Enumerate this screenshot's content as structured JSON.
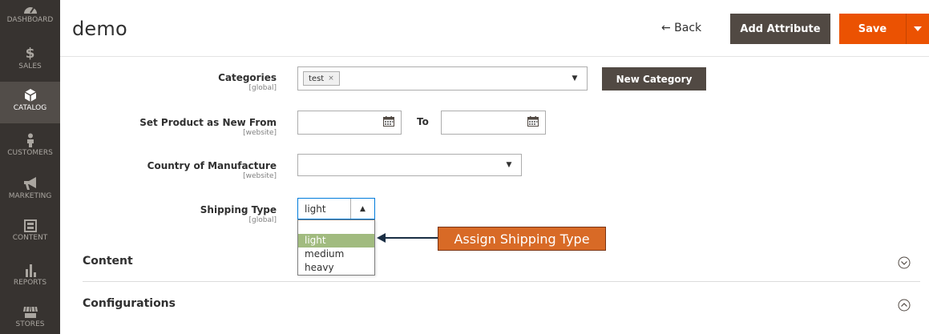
{
  "sidebar": {
    "items": [
      {
        "label": "DASHBOARD",
        "icon": "dashboard-icon"
      },
      {
        "label": "SALES",
        "icon": "dollar-icon"
      },
      {
        "label": "CATALOG",
        "icon": "cube-icon",
        "active": true
      },
      {
        "label": "CUSTOMERS",
        "icon": "person-icon"
      },
      {
        "label": "MARKETING",
        "icon": "megaphone-icon"
      },
      {
        "label": "CONTENT",
        "icon": "layout-icon"
      },
      {
        "label": "REPORTS",
        "icon": "bar-chart-icon"
      },
      {
        "label": "STORES",
        "icon": "store-icon"
      }
    ]
  },
  "header": {
    "title": "demo",
    "back_label": "← Back",
    "add_attribute_label": "Add Attribute",
    "save_label": "Save"
  },
  "form": {
    "categories": {
      "label": "Categories",
      "scope": "[global]",
      "tag": "test",
      "tag_remove": "×",
      "new_category_label": "New Category"
    },
    "new_from": {
      "label": "Set Product as New From",
      "scope": "[website]",
      "from_value": "",
      "to_label": "To",
      "to_value": ""
    },
    "country": {
      "label": "Country of Manufacture",
      "scope": "[website]",
      "value": ""
    },
    "shipping_type": {
      "label": "Shipping Type",
      "scope": "[global]",
      "value": "light",
      "options": [
        "",
        "light",
        "medium",
        "heavy"
      ],
      "highlighted": "light"
    }
  },
  "annotation": {
    "text": "Assign Shipping Type"
  },
  "sections": [
    {
      "title": "Content",
      "state": "collapsed"
    },
    {
      "title": "Configurations",
      "state": "expanded"
    }
  ],
  "colors": {
    "sidebar_bg": "#373330",
    "primary": "#eb5202",
    "secondary": "#514943",
    "annotation": "#d86a26",
    "highlight": "#a1bb7f"
  }
}
